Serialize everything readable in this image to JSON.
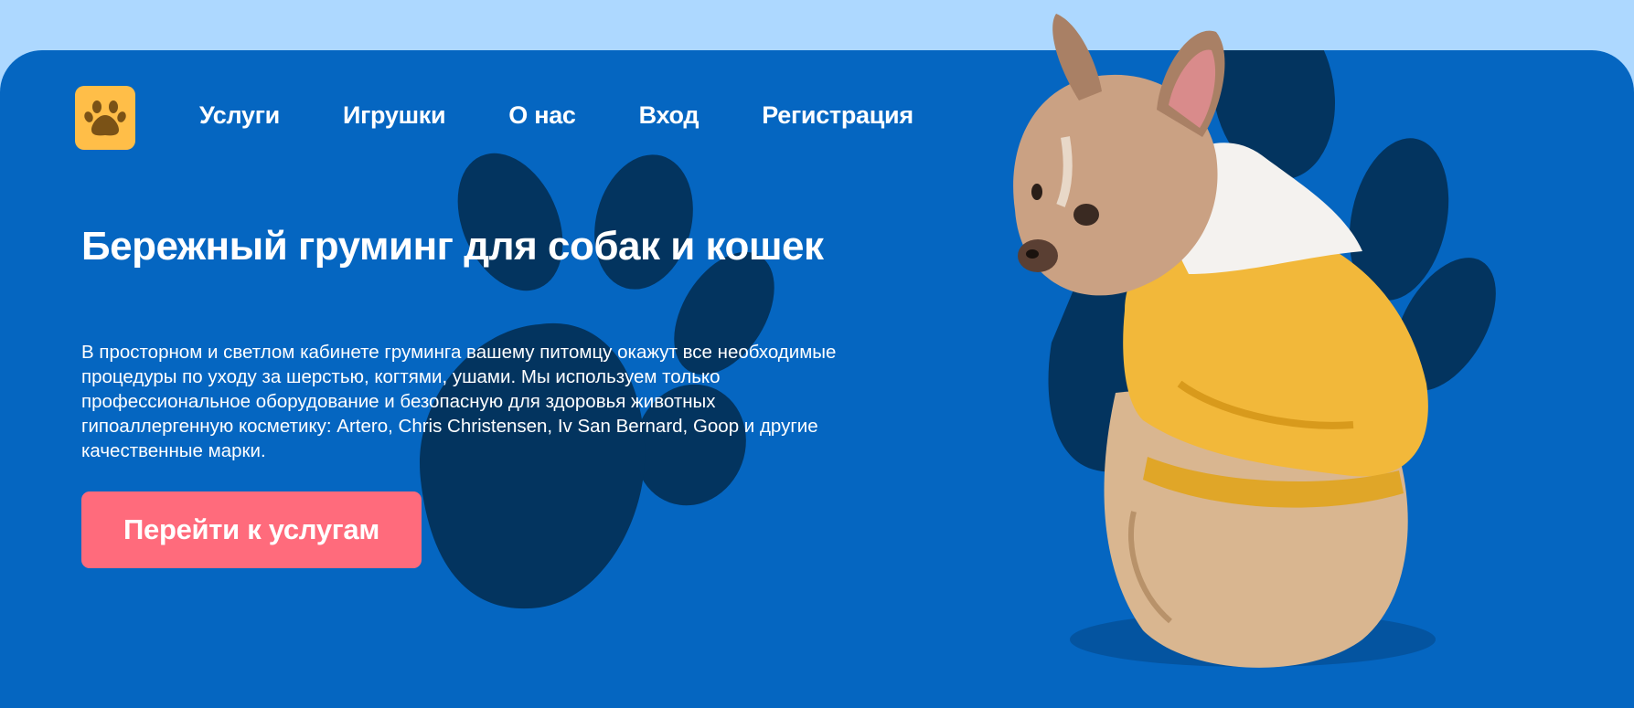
{
  "nav": {
    "logo_icon": "paw-icon",
    "items": [
      "Услуги",
      "Игрушки",
      "О нас",
      "Вход",
      "Регистрация"
    ]
  },
  "hero": {
    "title": "Бережный груминг для собак и кошек",
    "description": "В просторном и светлом кабинете груминга вашему питомцу окажут все необходимые процедуры по уходу за шерстью, когтями, ушами. Мы используем только профессиональное оборудование и безопасную для здоровья животных гипоаллергенную косметику: Artero, Chris Christensen, Iv San Bernard, Goop и другие качественные марки.",
    "cta_label": "Перейти к услугам",
    "image": "french-bulldog-in-yellow-hoodie"
  },
  "colors": {
    "page_bg": "#add8ff",
    "hero_bg": "#0566c1",
    "paw_shape": "#03345f",
    "logo_bg": "#ffbe48",
    "logo_paw": "#7a5216",
    "cta_bg": "#ff6b7c",
    "text": "#ffffff"
  }
}
